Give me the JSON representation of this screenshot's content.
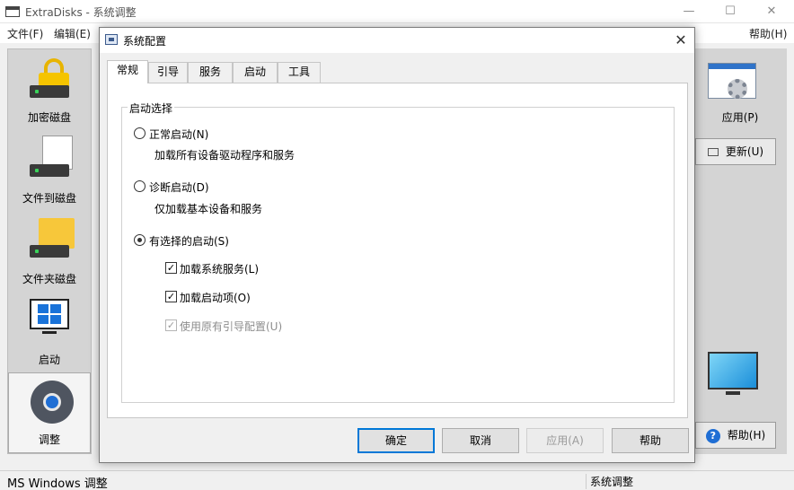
{
  "main_window": {
    "title": "ExtraDisks - 系统调整",
    "controls": {
      "minimize": "—",
      "maximize": "☐",
      "close": "✕"
    },
    "menu": {
      "file": "文件(F)",
      "edit": "编辑(E)",
      "help": "帮助(H)"
    },
    "left_items": [
      {
        "label": "加密磁盘",
        "icon": "lock-drive-icon"
      },
      {
        "label": "文件到磁盘",
        "icon": "file-drive-icon"
      },
      {
        "label": "文件夹磁盘",
        "icon": "folder-drive-icon"
      },
      {
        "label": "启动",
        "icon": "windows-monitor-icon"
      },
      {
        "label": "调整",
        "icon": "gear-icon"
      }
    ],
    "right_panel": {
      "apply": "应用(P)",
      "refresh": "更新(U)",
      "help": "帮助(H)",
      "help_glyph": "?"
    },
    "status": {
      "left": "MS Windows 调整",
      "right": "系统调整"
    }
  },
  "dialog": {
    "title": "系统配置",
    "close": "✕",
    "tabs": [
      "常规",
      "引导",
      "服务",
      "启动",
      "工具"
    ],
    "active_tab": 0,
    "group_label": "启动选择",
    "options": {
      "normal": {
        "label": "正常启动(N)",
        "desc": "加载所有设备驱动程序和服务",
        "selected": false
      },
      "diagnostic": {
        "label": "诊断启动(D)",
        "desc": "仅加载基本设备和服务",
        "selected": false
      },
      "selective": {
        "label": "有选择的启动(S)",
        "selected": true
      }
    },
    "checkboxes": {
      "load_services": {
        "label": "加载系统服务(L)",
        "checked": true,
        "glyph": "✓"
      },
      "load_startup": {
        "label": "加载启动项(O)",
        "checked": true,
        "glyph": "✓"
      },
      "use_original_boot": {
        "label": "使用原有引导配置(U)",
        "checked": true,
        "disabled": true,
        "glyph": "✓"
      }
    },
    "buttons": {
      "ok": "确定",
      "cancel": "取消",
      "apply": "应用(A)",
      "help": "帮助"
    }
  }
}
